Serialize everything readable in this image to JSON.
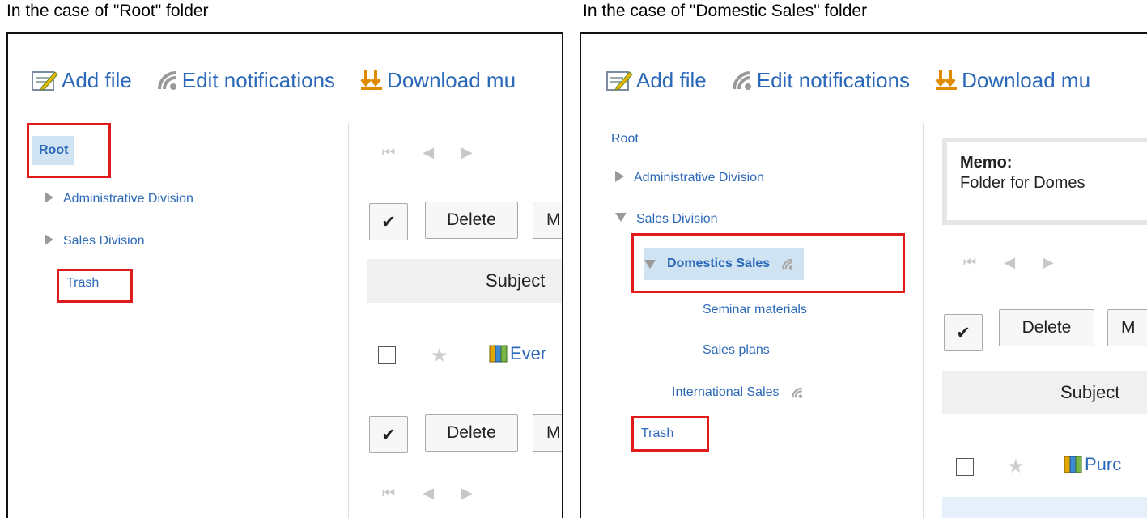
{
  "left": {
    "caption": "In the case of \"Root\" folder",
    "toolbar": {
      "add_file": "Add file",
      "edit_notifications": "Edit notifications",
      "download": "Download mu"
    },
    "tree": {
      "root": "Root",
      "admin": "Administrative Division",
      "sales": "Sales Division",
      "trash": "Trash"
    },
    "check_symbol": "✔",
    "delete": "Delete",
    "move_partial": "M",
    "subject": "Subject",
    "row_link": "Ever"
  },
  "right": {
    "caption": "In the case of \"Domestic Sales\" folder",
    "toolbar": {
      "add_file": "Add file",
      "edit_notifications": "Edit notifications",
      "download": "Download mu"
    },
    "tree": {
      "root": "Root",
      "admin": "Administrative Division",
      "sales": "Sales Division",
      "domestic": "Domestics Sales",
      "seminar": "Seminar materials",
      "plans": "Sales plans",
      "international": "International Sales",
      "trash": "Trash"
    },
    "memo_title": "Memo:",
    "memo_text": "Folder for Domes",
    "check_symbol": "✔",
    "delete": "Delete",
    "move_partial": "M",
    "subject": "Subject",
    "row_link": "Purc"
  },
  "colors": {
    "link": "#2b69b8",
    "highlight_box": "#e01b1b",
    "selected_bg": "#cfe3f3"
  }
}
